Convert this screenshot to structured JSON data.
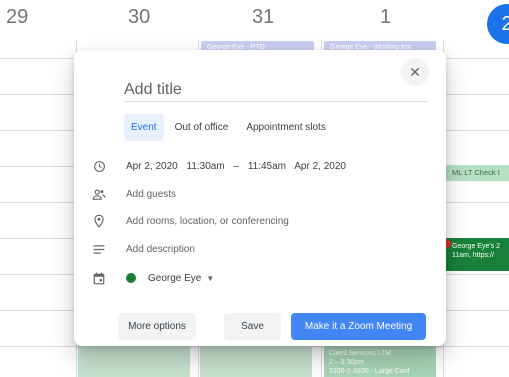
{
  "calendar": {
    "days": [
      "29",
      "30",
      "31",
      "1",
      "2"
    ],
    "allday_events": [
      "George Eye - PTO",
      "George Eye - Working fror"
    ],
    "events": {
      "ml_lt": "ML LT Check I",
      "george_line1": "George Eye's 2",
      "george_line2": "11am, https://",
      "cs_line1": "Client Services LTM",
      "cs_line2": "2 – 3:30pm",
      "cs_line3": "3100-1-3100 - Large Conf"
    }
  },
  "dialog": {
    "close_symbol": "✕",
    "title_placeholder": "Add title",
    "tabs": [
      "Event",
      "Out of office",
      "Appointment slots"
    ],
    "datetime": {
      "start_date": "Apr 2, 2020",
      "start_time": "11:30am",
      "separator": "–",
      "end_time": "11:45am",
      "end_date": "Apr 2, 2020"
    },
    "guests_placeholder": "Add guests",
    "location_placeholder": "Add rooms, location, or conferencing",
    "description_placeholder": "Add description",
    "calendar_name": "George Eye",
    "calendar_color": "#188038",
    "caret": "▼",
    "buttons": {
      "more": "More options",
      "save": "Save",
      "zoom": "Make it a Zoom Meeting"
    },
    "icons": [
      "clock-icon",
      "people-icon",
      "location-icon",
      "description-icon",
      "calendar-icon"
    ],
    "accent_color": "#1a73e8",
    "zoom_color": "#4285f4"
  }
}
